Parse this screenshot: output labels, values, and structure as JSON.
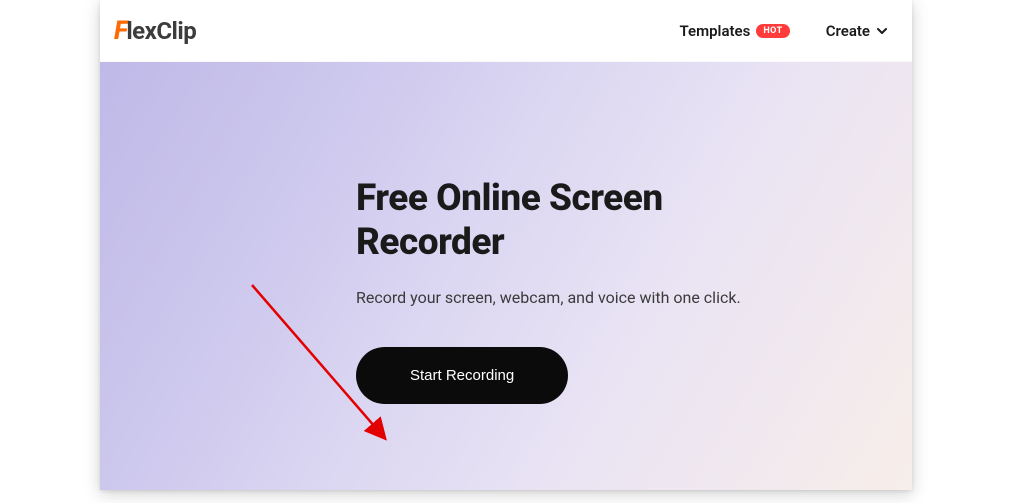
{
  "header": {
    "logo": {
      "accent": "F",
      "rest": "lexClip"
    },
    "nav": {
      "templates": {
        "label": "Templates",
        "badge": "HOT"
      },
      "create": {
        "label": "Create"
      }
    }
  },
  "hero": {
    "title_line1": "Free Online Screen",
    "title_line2": "Recorder",
    "subtitle": "Record your screen, webcam, and voice with one click.",
    "cta_label": "Start Recording"
  }
}
